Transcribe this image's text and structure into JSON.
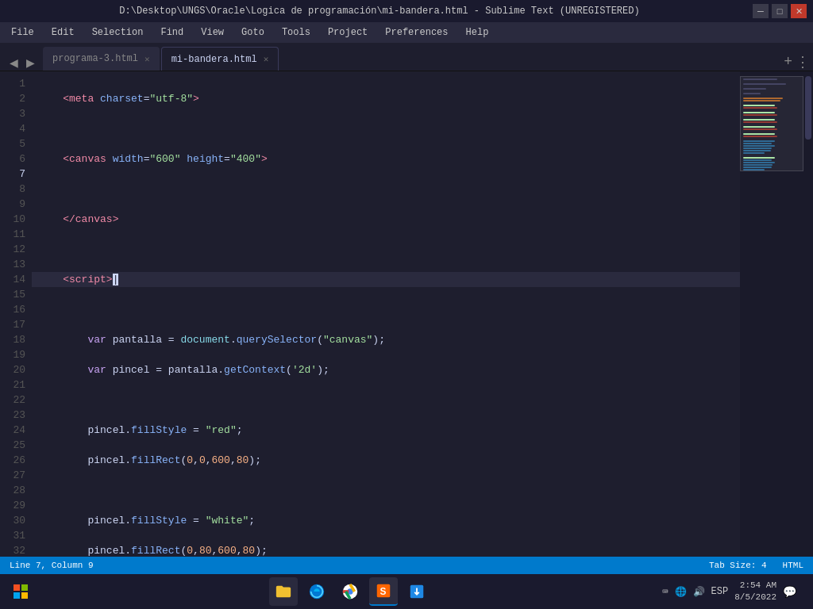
{
  "titlebar": {
    "title": "D:\\Desktop\\UNGS\\Oracle\\Logica de programación\\mi-bandera.html - Sublime Text (UNREGISTERED)",
    "min_btn": "─",
    "max_btn": "□",
    "close_btn": "✕"
  },
  "menubar": {
    "items": [
      "File",
      "Edit",
      "Selection",
      "Find",
      "View",
      "Goto",
      "Tools",
      "Project",
      "Preferences",
      "Help"
    ]
  },
  "tabs": {
    "nav_left": "◀",
    "nav_right": "▶",
    "items": [
      {
        "label": "programa-3.html",
        "active": false
      },
      {
        "label": "mi-bandera.html",
        "active": true
      }
    ],
    "add_btn": "+",
    "overflow_btn": "⋮"
  },
  "statusbar": {
    "line_col": "Line 7, Column 9",
    "tab_size": "Tab Size: 4",
    "syntax": "HTML"
  },
  "taskbar": {
    "start_icon": "⊞",
    "time": "2:54 AM",
    "date": "8/5/2022",
    "lang": "ESP",
    "apps": [
      {
        "name": "Windows Start",
        "icon": "⊞"
      },
      {
        "name": "File Explorer",
        "icon": "📁"
      },
      {
        "name": "Edge",
        "icon": "🌐"
      },
      {
        "name": "Chrome",
        "icon": "🔵"
      },
      {
        "name": "Sublime Text",
        "icon": "S"
      },
      {
        "name": "Downloads",
        "icon": "📥"
      }
    ]
  }
}
